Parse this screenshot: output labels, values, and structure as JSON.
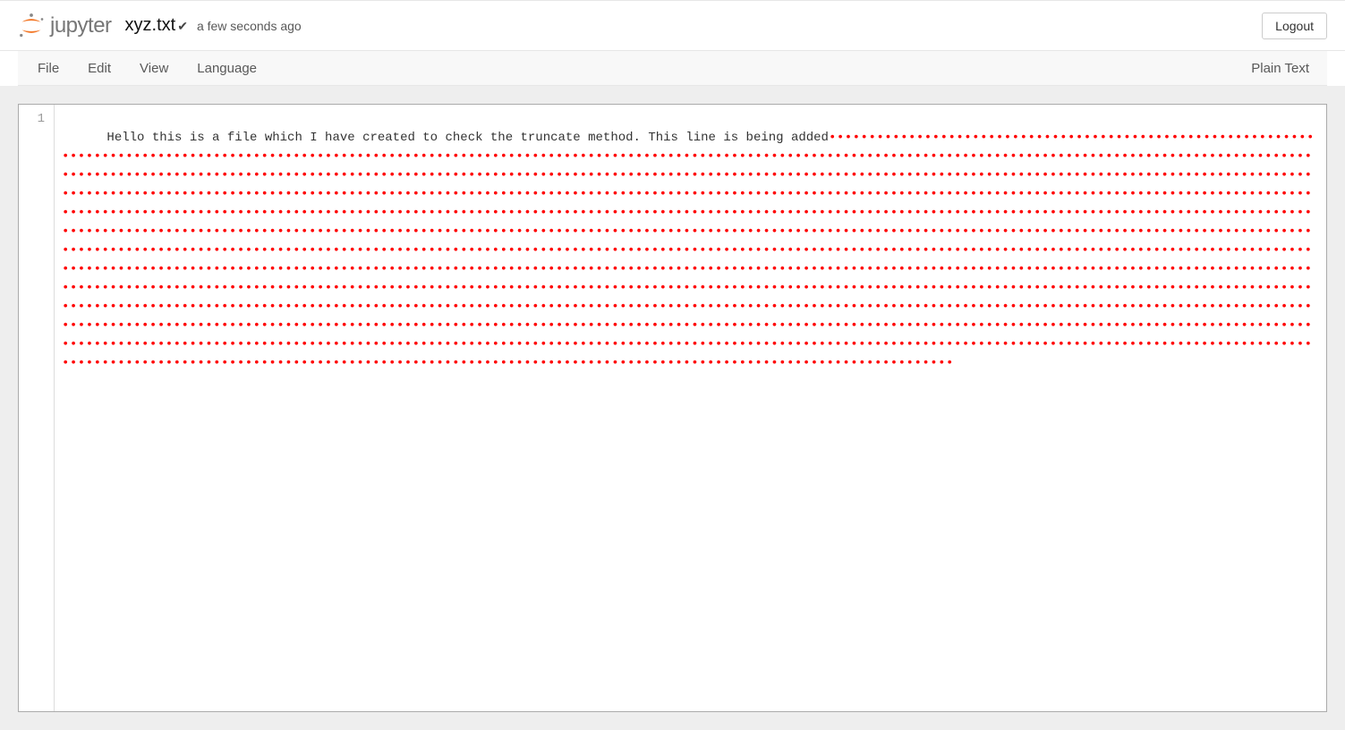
{
  "header": {
    "logoText": "jupyter",
    "filename": "xyz.txt",
    "savedAgo": "a few seconds ago",
    "logoutLabel": "Logout"
  },
  "menubar": {
    "items": [
      "File",
      "Edit",
      "View",
      "Language"
    ],
    "mode": "Plain Text"
  },
  "editor": {
    "gutter": [
      "1"
    ],
    "line1_text": "Hello this is a file which I have created to check the truncate method. This line is being added",
    "line1_trailing_count": 1900,
    "trailing_char": "•"
  }
}
